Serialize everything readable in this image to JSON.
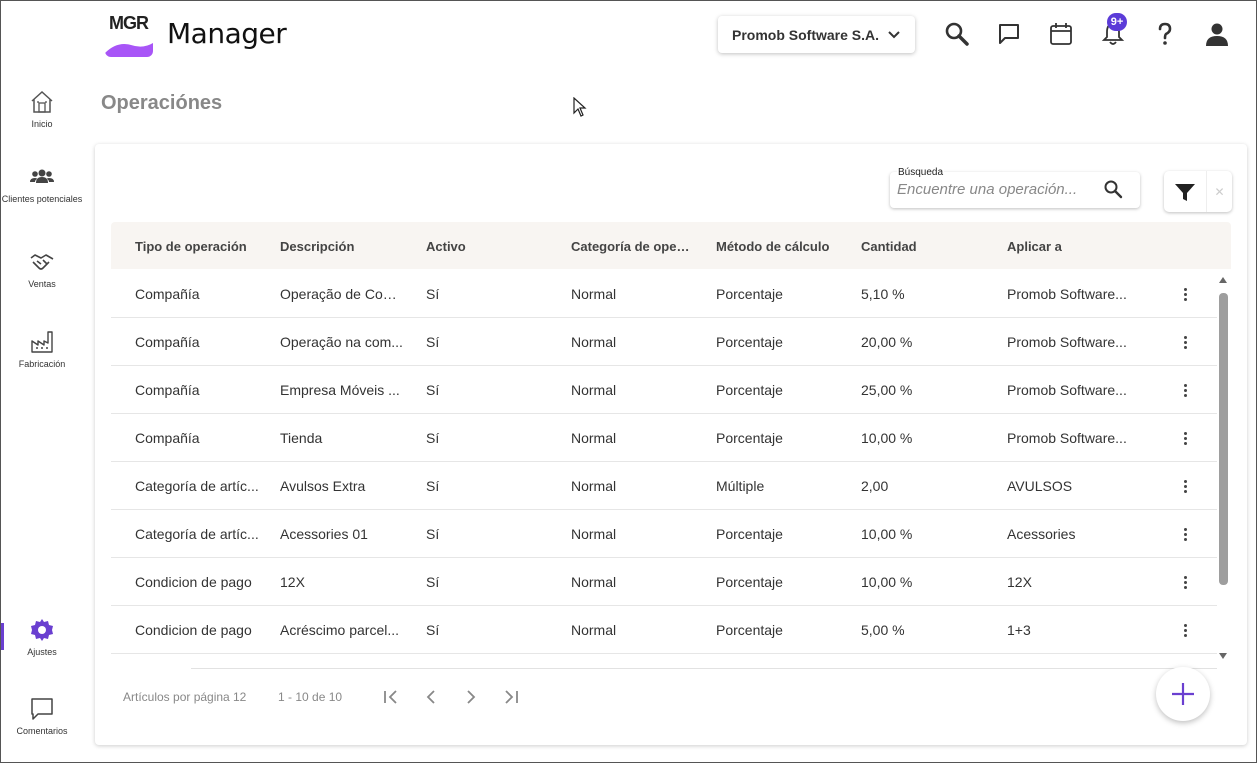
{
  "header": {
    "logo_text": "MGR",
    "app_title": "Manager",
    "company": "Promob Software S.A.",
    "notification_count": "9+"
  },
  "colors": {
    "accent": "#6a3fd0",
    "logo_purple": "#a855f7",
    "badge": "#5b3bd8"
  },
  "sidebar": {
    "items": [
      {
        "label": "Inicio",
        "icon": "home-icon"
      },
      {
        "label": "Clientes potenciales",
        "icon": "people-icon"
      },
      {
        "label": "Ventas",
        "icon": "handshake-icon"
      },
      {
        "label": "Fabricación",
        "icon": "factory-icon"
      },
      {
        "label": "Ajustes",
        "icon": "gear-icon"
      },
      {
        "label": "Comentarios",
        "icon": "comment-icon"
      }
    ]
  },
  "page": {
    "title": "Operaciónes"
  },
  "search": {
    "label": "Búsqueda",
    "placeholder": "Encuentre una operación..."
  },
  "table": {
    "columns": [
      "Tipo de operación",
      "Descripción",
      "Activo",
      "Categoría de opera...",
      "Método de cálculo",
      "Cantidad",
      "Aplicar a"
    ],
    "rows": [
      [
        "Compañía",
        "Operação de Com...",
        "Sí",
        "Normal",
        "Porcentaje",
        "5,10 %",
        "Promob Software..."
      ],
      [
        "Compañía",
        "Operação na com...",
        "Sí",
        "Normal",
        "Porcentaje",
        "20,00 %",
        "Promob Software..."
      ],
      [
        "Compañía",
        "Empresa Móveis ...",
        "Sí",
        "Normal",
        "Porcentaje",
        "25,00 %",
        "Promob Software..."
      ],
      [
        "Compañía",
        "Tienda",
        "Sí",
        "Normal",
        "Porcentaje",
        "10,00 %",
        "Promob Software..."
      ],
      [
        "Categoría de artíc...",
        "Avulsos Extra",
        "Sí",
        "Normal",
        "Múltiple",
        "2,00",
        "AVULSOS"
      ],
      [
        "Categoría de artíc...",
        "Acessories 01",
        "Sí",
        "Normal",
        "Porcentaje",
        "10,00 %",
        "Acessories"
      ],
      [
        "Condicion de pago",
        "12X",
        "Sí",
        "Normal",
        "Porcentaje",
        "10,00 %",
        "12X"
      ],
      [
        "Condicion de pago",
        "Acréscimo parcel...",
        "Sí",
        "Normal",
        "Porcentaje",
        "5,00 %",
        "1+3"
      ]
    ]
  },
  "pagination": {
    "per_page_label": "Artículos por página",
    "per_page_value": "12",
    "range": "1 - 10 de 10"
  }
}
